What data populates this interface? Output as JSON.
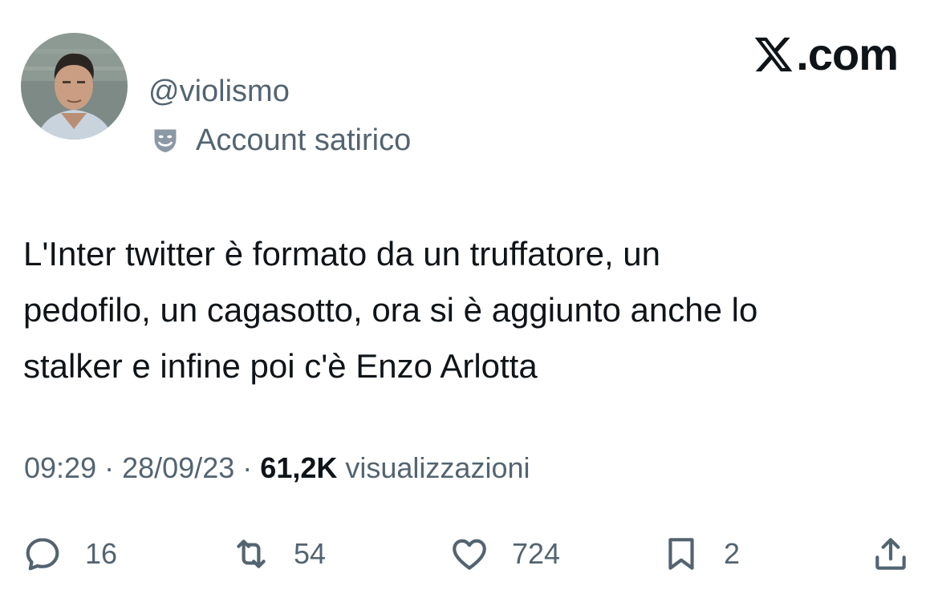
{
  "header": {
    "handle": "@violismo",
    "account_label": "Account satirico",
    "account_label_icon": "theater-mask-icon",
    "brand": ".com",
    "brand_icon": "x-logo-icon"
  },
  "tweet": {
    "text_lines": [
      "L'Inter twitter è formato da un truffatore, un",
      "pedofilo, un cagasotto, ora si è aggiunto anche lo",
      "stalker e infine poi c'è Enzo Arlotta"
    ],
    "time": "09:29",
    "date": "28/09/23",
    "views_count": "61,2K",
    "views_label": "visualizzazioni",
    "separator": "·"
  },
  "actions": {
    "replies": {
      "icon": "reply-icon",
      "count": "16"
    },
    "reposts": {
      "icon": "repost-icon",
      "count": "54"
    },
    "likes": {
      "icon": "heart-icon",
      "count": "724"
    },
    "bookmarks": {
      "icon": "bookmark-icon",
      "count": "2"
    },
    "share": {
      "icon": "share-icon"
    }
  },
  "colors": {
    "text_primary": "#0f1419",
    "text_secondary": "#536471",
    "background": "#ffffff"
  }
}
